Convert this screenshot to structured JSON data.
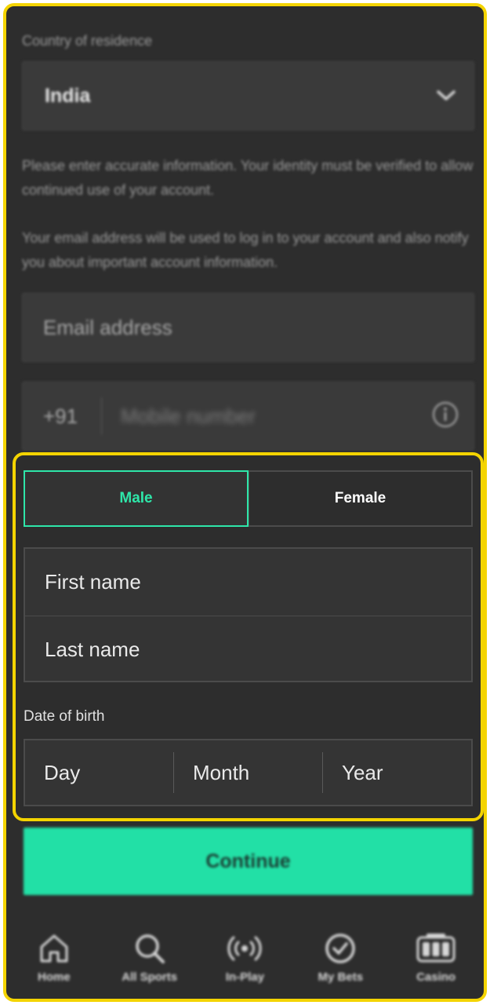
{
  "country": {
    "label": "Country of residence",
    "value": "India"
  },
  "info": {
    "identity_text": "Please enter accurate information. Your identity must be verified to allow continued use of your account.",
    "email_text": "Your email address will be used to log in to your account and also notify you about important account information."
  },
  "email": {
    "placeholder": "Email address"
  },
  "phone": {
    "code": "+91",
    "placeholder": "Mobile number"
  },
  "gender": {
    "male": "Male",
    "female": "Female",
    "selected": "Male"
  },
  "names": {
    "first": "First name",
    "last": "Last name"
  },
  "dob": {
    "label": "Date of birth",
    "day": "Day",
    "month": "Month",
    "year": "Year"
  },
  "actions": {
    "continue": "Continue"
  },
  "nav": {
    "items": [
      {
        "label": "Home",
        "icon": "home-icon"
      },
      {
        "label": "All Sports",
        "icon": "search-icon"
      },
      {
        "label": "In-Play",
        "icon": "broadcast-icon"
      },
      {
        "label": "My Bets",
        "icon": "check-circle-icon"
      },
      {
        "label": "Casino",
        "icon": "slot-machine-icon"
      }
    ]
  },
  "colors": {
    "accent": "#2ee6a9",
    "button": "#22e0a6",
    "background": "#2d2d2d",
    "highlight": "#f4d400"
  }
}
